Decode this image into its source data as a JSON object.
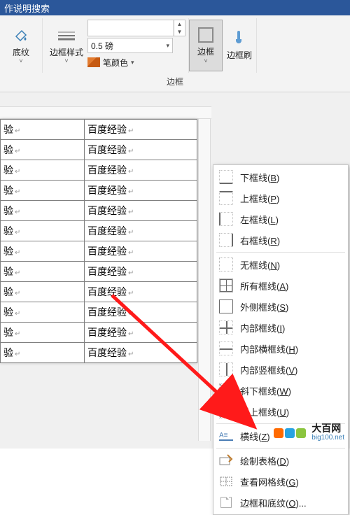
{
  "title": "作说明搜索",
  "ribbon": {
    "shading": {
      "label": "底纹",
      "drop": "˅"
    },
    "borderStyle": {
      "label": "边框样式",
      "drop": "˅"
    },
    "weight": {
      "value": "0.5 磅"
    },
    "penColor": {
      "label": "笔颜色",
      "drop": "˅"
    },
    "border": {
      "label": "边框",
      "drop": "˅"
    },
    "borderBrush": {
      "label": "边框刷"
    },
    "groupLabel": "边框"
  },
  "table": {
    "col0": [
      "验",
      "验",
      "验",
      "验",
      "验",
      "验",
      "验",
      "验",
      "验",
      "验",
      "验",
      "验"
    ],
    "col1": [
      "百度经验",
      "百度经验",
      "百度经验",
      "百度经验",
      "百度经验",
      "百度经验",
      "百度经验",
      "百度经验",
      "百度经验",
      "百度经验",
      "百度经验",
      "百度经验"
    ]
  },
  "menu": {
    "items": [
      {
        "label": "下框线(B)",
        "icon": "bottom"
      },
      {
        "label": "上框线(P)",
        "icon": "top"
      },
      {
        "label": "左框线(L)",
        "icon": "left"
      },
      {
        "label": "右框线(R)",
        "icon": "right"
      },
      {
        "sep": true
      },
      {
        "label": "无框线(N)",
        "icon": "none"
      },
      {
        "label": "所有框线(A)",
        "icon": "all"
      },
      {
        "label": "外侧框线(S)",
        "icon": "outside"
      },
      {
        "label": "内部框线(I)",
        "icon": "inside"
      },
      {
        "label": "内部横框线(H)",
        "icon": "insideh"
      },
      {
        "label": "内部竖框线(V)",
        "icon": "insidev"
      },
      {
        "label": "斜下框线(W)",
        "icon": "diagdown"
      },
      {
        "label": "斜上框线(U)",
        "icon": "diagup"
      },
      {
        "sep": true
      },
      {
        "label": "横线(Z)",
        "icon": "hline"
      },
      {
        "sep": true
      },
      {
        "label": "绘制表格(D)",
        "icon": "draw"
      },
      {
        "label": "查看网格线(G)",
        "icon": "grid"
      },
      {
        "label": "边框和底纹(O)...",
        "icon": "page"
      }
    ]
  },
  "watermark": {
    "brand": "大百网",
    "site": "big100.net"
  }
}
